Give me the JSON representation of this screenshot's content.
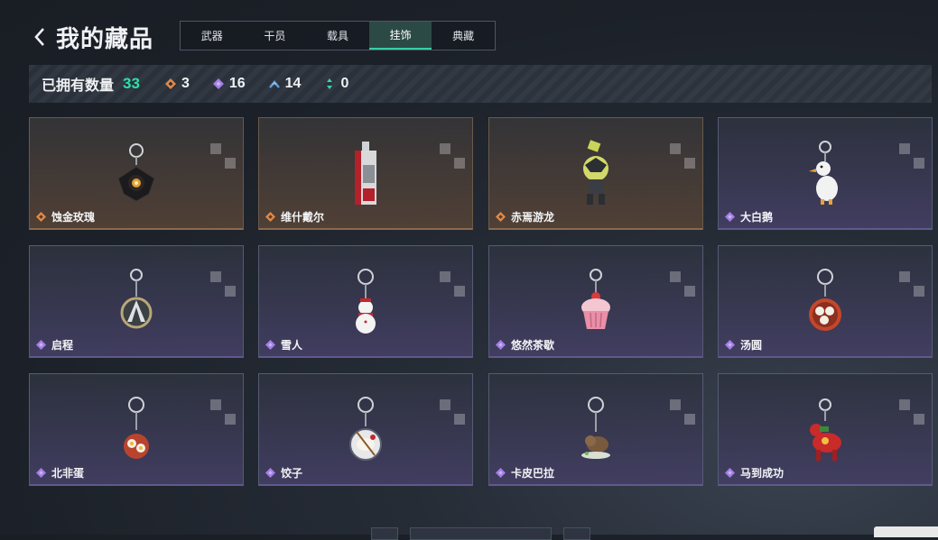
{
  "header": {
    "title": "我的藏品",
    "back_icon": "chevron-left-icon"
  },
  "tabs": [
    {
      "label": "武器",
      "active": false
    },
    {
      "label": "干员",
      "active": false
    },
    {
      "label": "载具",
      "active": false
    },
    {
      "label": "挂饰",
      "active": true
    },
    {
      "label": "典藏",
      "active": false
    }
  ],
  "stats": {
    "label": "已拥有数量",
    "total": "33",
    "rarities": [
      {
        "icon": "orange-diamond-icon",
        "color": "#e0894a",
        "count": "3"
      },
      {
        "icon": "purple-diamond-icon",
        "color": "#a47ee6",
        "count": "16"
      },
      {
        "icon": "blue-chevron-icon",
        "color": "#5aa2e8",
        "count": "14"
      },
      {
        "icon": "green-arrows-icon",
        "color": "#36d6a6",
        "count": "0"
      }
    ]
  },
  "items": [
    {
      "name": "蚀金玫瑰",
      "rarity": "orange",
      "icon": "gold-rose-charm-icon"
    },
    {
      "name": "维什戴尔",
      "rarity": "orange",
      "icon": "card-charm-icon"
    },
    {
      "name": "赤焉游龙",
      "rarity": "orange",
      "icon": "dragon-charm-icon"
    },
    {
      "name": "大白鹅",
      "rarity": "purple",
      "icon": "goose-charm-icon"
    },
    {
      "name": "启程",
      "rarity": "purple",
      "icon": "badge-charm-icon"
    },
    {
      "name": "雪人",
      "rarity": "purple",
      "icon": "snowman-charm-icon"
    },
    {
      "name": "悠然茶歇",
      "rarity": "purple",
      "icon": "cupcake-charm-icon"
    },
    {
      "name": "汤圆",
      "rarity": "purple",
      "icon": "tangyuan-charm-icon"
    },
    {
      "name": "北非蛋",
      "rarity": "purple",
      "icon": "shakshuka-charm-icon"
    },
    {
      "name": "饺子",
      "rarity": "purple",
      "icon": "dumpling-charm-icon"
    },
    {
      "name": "卡皮巴拉",
      "rarity": "purple",
      "icon": "capybara-charm-icon"
    },
    {
      "name": "马到成功",
      "rarity": "purple",
      "icon": "horse-charm-icon"
    }
  ]
}
